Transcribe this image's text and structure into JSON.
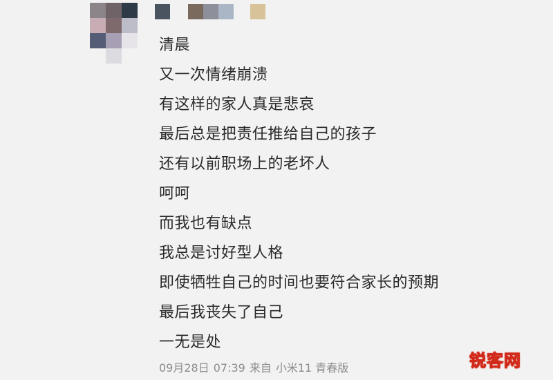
{
  "post": {
    "lines": [
      "清晨",
      "又一次情绪崩溃",
      "有这样的家人真是悲哀",
      "最后总是把责任推给自己的孩子",
      "还有以前职场上的老坏人",
      "呵呵",
      "而我也有缺点",
      "我总是讨好型人格",
      "即使牺牲自己的时间也要符合家长的预期",
      "最后我丧失了自己",
      "一无是处"
    ],
    "meta": {
      "date": "09月28日",
      "time": "07:39",
      "source_prefix": "来自",
      "device": "小米11 青春版"
    }
  },
  "watermark": "锐客网",
  "colors": {
    "background": "#f2f2f2",
    "text": "#2a2a2a",
    "meta_text": "#8c8c8c",
    "watermark_outline": "#d12a1a"
  }
}
